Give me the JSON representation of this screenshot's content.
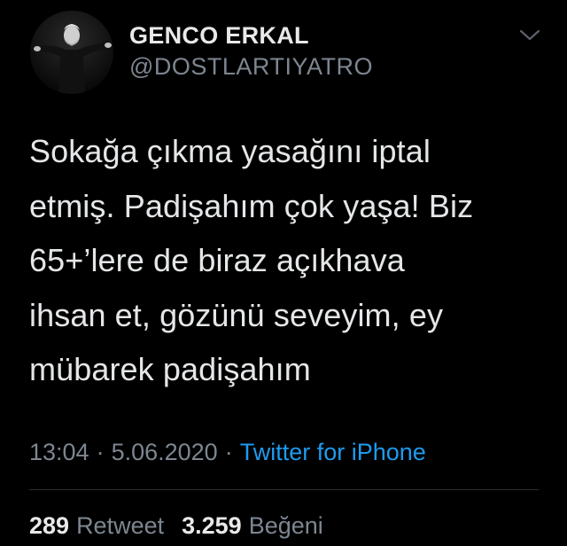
{
  "tweet": {
    "author": {
      "display_name": "GENCO ERKAL",
      "handle": "@DOSTLARTIYATRO",
      "avatar_icon": "avatar-photo"
    },
    "menu_icon": "chevron-down-icon",
    "text": "Sokağa çıkma yasağını iptal\netmiş. Padişahım çok yaşa! Biz\n65+’lere de biraz açıkhava\nihsan et, gözünü seveyim, ey\nmübarek padişahım",
    "time": "13:04",
    "separator": "·",
    "date": "5.06.2020",
    "source": "Twitter for iPhone",
    "stats": {
      "retweets_count": "289",
      "retweets_label": "Retweet",
      "likes_count": "3.259",
      "likes_label": "Beğeni"
    }
  },
  "colors": {
    "background": "#000000",
    "primary_text": "#e4e6e8",
    "secondary_text": "#7d8690",
    "link": "#1d9bf0",
    "divider": "#2a2f33"
  }
}
